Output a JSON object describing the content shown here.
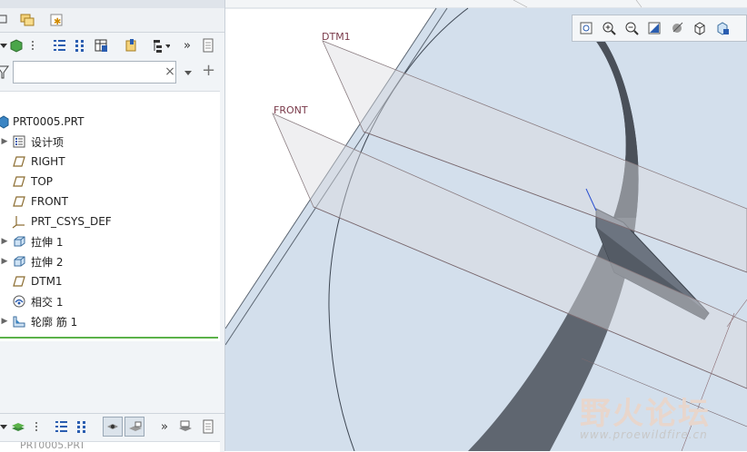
{
  "model_tree": {
    "search": {
      "value": "",
      "placeholder": ""
    },
    "items": [
      {
        "label": "PRT0005.PRT",
        "expandable": false,
        "icon": "part-icon"
      },
      {
        "label": "设计项",
        "expandable": true,
        "icon": "design-items-icon"
      },
      {
        "label": "RIGHT",
        "expandable": false,
        "icon": "datum-plane-icon"
      },
      {
        "label": "TOP",
        "expandable": false,
        "icon": "datum-plane-icon"
      },
      {
        "label": "FRONT",
        "expandable": false,
        "icon": "datum-plane-icon"
      },
      {
        "label": "PRT_CSYS_DEF",
        "expandable": false,
        "icon": "csys-icon"
      },
      {
        "label": "拉伸 1",
        "expandable": true,
        "icon": "extrude-icon"
      },
      {
        "label": "拉伸 2",
        "expandable": true,
        "icon": "extrude-icon"
      },
      {
        "label": "DTM1",
        "expandable": false,
        "icon": "datum-plane-icon"
      },
      {
        "label": "相交 1",
        "expandable": false,
        "icon": "intersect-icon"
      },
      {
        "label": "轮廓 筋 1",
        "expandable": true,
        "icon": "profile-rib-icon"
      }
    ],
    "bottom_label": "PRT0005.PRT"
  },
  "viewport": {
    "datum_labels": {
      "dtm1": "DTM1",
      "front": "FRONT"
    },
    "watermark": {
      "title": "野火论坛",
      "url": "www.proewildfire.cn"
    }
  },
  "colors": {
    "selection_line": "#5bb24a",
    "datum_label": "#7a3a4a",
    "model_face": "#5f6670"
  }
}
